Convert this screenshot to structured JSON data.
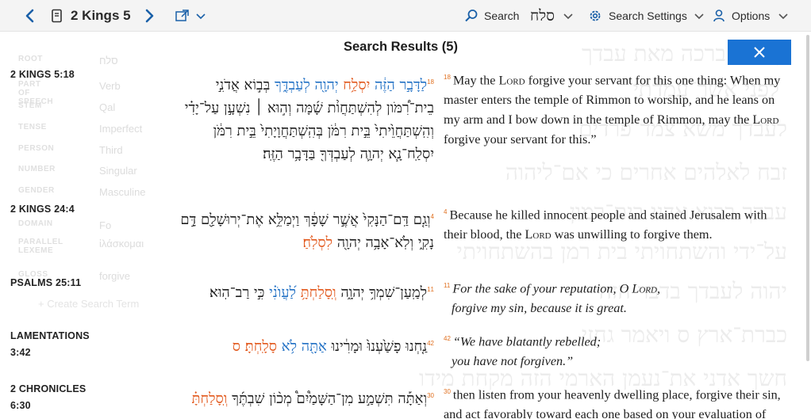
{
  "toolbar": {
    "reference": "2 Kings 5",
    "search_label": "Search",
    "search_query": "סלח",
    "search_settings_label": "Search Settings",
    "options_label": "Options"
  },
  "background": {
    "hebrew_lines": [
      "קח־נא ברכה מאת עבדך",
      "לפני אשר־עמדתי",
      "לעבדך משא צמד־פרדים",
      "זבח לאלהים אחרים כי אם־ליהוה",
      "עבדך בבוא אדני בית־רמון",
      "על־ידי והשתחויתי בית רמן בהשתחויתי",
      "יהוה לעבדך בדבר הזה",
      "כברת־ארץ ס ויאמר גחזי",
      "חשך אדני את־נעמן הארמי הזה מקחת מידו"
    ],
    "fields": [
      {
        "key": "ROOT",
        "value": "סלח"
      },
      {
        "key": "PART OF SPEECH",
        "value": "Verb"
      },
      {
        "key": "STEM",
        "value": "Qal"
      },
      {
        "key": "TENSE",
        "value": "Imperfect"
      },
      {
        "key": "PERSON",
        "value": "Third"
      },
      {
        "key": "NUMBER",
        "value": "Singular"
      },
      {
        "key": "GENDER",
        "value": "Masculine"
      },
      {
        "key": "DOMAIN",
        "value": "Fo"
      },
      {
        "key": "PARALLEL LEXEME",
        "value": "ἱλάσκομαι"
      },
      {
        "key": "GLOSS",
        "value": "forgive"
      }
    ],
    "create_search_term": "+ Create Search Term"
  },
  "results": {
    "title": "Search Results (5)",
    "items": [
      {
        "reference": "2 KINGS 5:18",
        "verse_num": "18",
        "hebrew_html": "<span class=\"vnum\">18</span><span class=\"hl-b\">לַדָּבָ֣ר הַזֶּ֔ה</span> <span class=\"hl-o\">יִסְלַ֥ח</span> <span class=\"hl-b\">יְהוָ֖ה לְעַבְדֶּ֑ךָ</span> בְּב֣וֹא אֲדֹנִ֣י בֵית־רִ֠מֹּון לְהִשְׁתַּחֲוֹ֨ת שָׁ֜מָּה וְה֣וּא ׀ נִשְׁעָ֣ן עַל־יָדִ֗י וְהִֽשְׁתַּחֲוֵ֙יתִי֙ בֵּ֣ית רִמֹּ֔ן בְּהִֽשְׁתַּחֲוָיָתִי֙ בֵּ֣ית רִמֹּ֔ן יִסְלַֽח־נָ֧א יְהוָ֛ה לְעַבְדְּךָ֖ בַּדָּבָ֥ר הַזֶּֽה׃",
        "english_html": "<span class=\"vn\">18</span>May the <span class=\"sc\">Lord</span> forgive your servant for this one thing: When my master enters the temple of Rimmon to worship, and he leans on my arm and I bow down in the temple of Rimmon, may the <span class=\"sc\">Lord</span> forgive your servant for this.”"
      },
      {
        "reference": "2 KINGS 24:4",
        "verse_num": "4",
        "hebrew_html": "<span class=\"vnum\">4</span>וְגַ֤ם דַּֽם־הַנָּקִי֙ אֲשֶׁ֣ר שָׁפָ֔ךְ וַיְמַלֵּ֥א אֶת־יְרוּשָׁלִַ֖ם דָּ֣ם נָקִ֑י וְלֹֽא־אָבָ֥ה יְהוָ֖ה <span class=\"hl-o\">לִסְלֹֽחַ׃</span>",
        "english_html": "<span class=\"vn\">4</span>Because he killed innocent people and stained Jerusalem with their blood, the <span class=\"sc\">Lord</span> was unwilling to forgive them."
      },
      {
        "reference": "PSALMS 25:11",
        "verse_num": "11",
        "hebrew_html": "<span class=\"vnum\">11</span>לְמַֽעַן־שִׁמְךָ֥ יְהוָ֑ה <span class=\"hl-o\">וְֽסָלַחְתָּ֥</span> <span class=\"hl-b\">לַ֝עֲוֺנִ֗י</span> כִּ֣י רַב־הֽוּא׃",
        "english_html": "<span class=\"vn\">11</span><span class=\"txt\">For the sake of your reputation, O <span class=\"sc\">Lord</span>,</span><span class=\"ind txt\">forgive my sin, because it is great.</span>"
      },
      {
        "reference": "LAMENTATIONS 3:42",
        "verse_num": "42",
        "hebrew_html": "<span class=\"vnum\">42</span>נַ֤חְנוּ פָשַׁ֙עְנוּ֙ וּמָרִ֔ינוּ <span class=\"hl-b\">אַתָּ֖ה לֹ֥א</span> <span class=\"hl-o\">סָלָֽחְתָּ׃ ס</span>",
        "english_html": "<span class=\"vn\">42</span><span class=\"txt\">“We have blatantly rebelled;</span><span class=\"ind txt\">you have not forgiven.”</span>"
      },
      {
        "reference": "2 CHRONICLES 6:30",
        "verse_num": "30",
        "hebrew_html": "<span class=\"vnum\">30</span>וְאַתָּ֡ה תִּשְׁמַ֣ע מִן־הַשָּׁמַ֩יִם֩ מְכ֨וֹן שִׁבְתֶּ֜ךָ <span class=\"hl-o\">וְֽסָלַחְתָּ֗</span>",
        "english_html": "<span class=\"vn\">30</span>then listen from your heavenly dwelling place, forgive their sin, and act favorably toward each one based on your evaluation of"
      }
    ]
  }
}
